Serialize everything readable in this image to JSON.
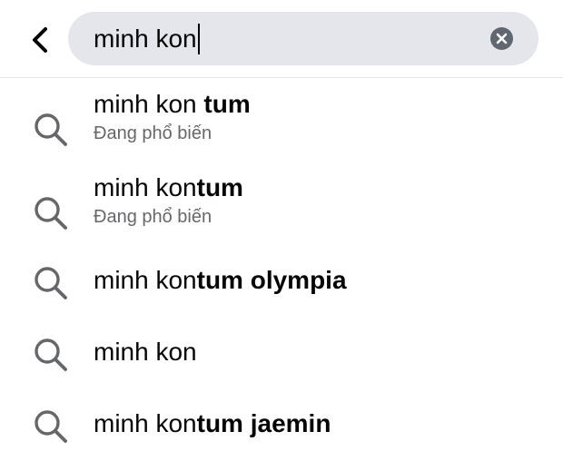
{
  "search": {
    "query": "minh kon",
    "icons": {
      "back": "chevron-left-icon",
      "clear": "close-circle-icon",
      "suggestion": "search-icon"
    }
  },
  "suggestions": [
    {
      "typed": "minh kon ",
      "completion": "tum",
      "subtitle": "Đang phổ biến"
    },
    {
      "typed": "minh kon",
      "completion": "tum",
      "subtitle": "Đang phổ biến"
    },
    {
      "typed": "minh kon",
      "completion": "tum olympia",
      "subtitle": ""
    },
    {
      "typed": "minh kon",
      "completion": "",
      "subtitle": ""
    },
    {
      "typed": "minh kon",
      "completion": "tum jaemin",
      "subtitle": ""
    }
  ],
  "colors": {
    "field_background": "#e4e6eb",
    "icon_gray": "#65676b",
    "text_primary": "#050505",
    "text_secondary": "#65676b"
  }
}
